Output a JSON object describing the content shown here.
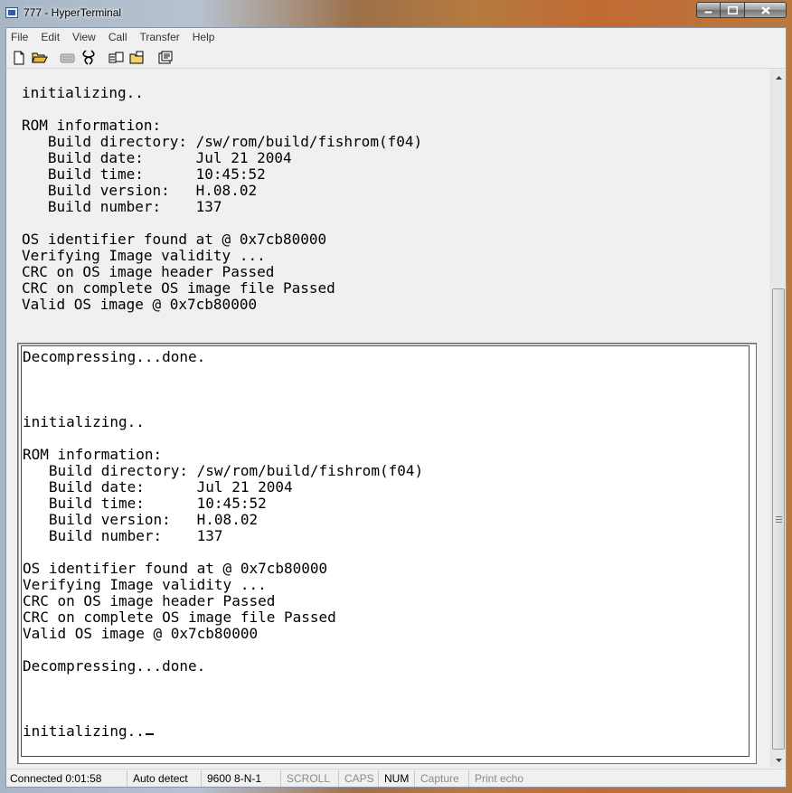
{
  "window": {
    "title": "777 - HyperTerminal",
    "minimize_glyph": "▬",
    "maximize_glyph": "□",
    "close_glyph": "✕"
  },
  "menu": [
    "File",
    "Edit",
    "View",
    "Call",
    "Transfer",
    "Help"
  ],
  "toolbar": {
    "icons": [
      "new-icon",
      "open-icon",
      "connect-icon",
      "disconnect-icon",
      "send-icon",
      "receive-icon",
      "properties-icon"
    ]
  },
  "terminal": {
    "history_lines": [
      "initializing..",
      "",
      "ROM information:",
      "   Build directory: /sw/rom/build/fishrom(f04)",
      "   Build date:      Jul 21 2004",
      "   Build time:      10:45:52",
      "   Build version:   H.08.02",
      "   Build number:    137",
      "",
      "OS identifier found at @ 0x7cb80000",
      "Verifying Image validity ...",
      "CRC on OS image header Passed",
      "CRC on complete OS image file Passed",
      "Valid OS image @ 0x7cb80000"
    ],
    "screen_lines": [
      "Decompressing...done.",
      "",
      "",
      "",
      "initializing..",
      "",
      "ROM information:",
      "   Build directory: /sw/rom/build/fishrom(f04)",
      "   Build date:      Jul 21 2004",
      "   Build time:      10:45:52",
      "   Build version:   H.08.02",
      "   Build number:    137",
      "",
      "OS identifier found at @ 0x7cb80000",
      "Verifying Image validity ...",
      "CRC on OS image header Passed",
      "CRC on complete OS image file Passed",
      "Valid OS image @ 0x7cb80000",
      "",
      "Decompressing...done.",
      "",
      "",
      "",
      "initializing.."
    ]
  },
  "statusbar": {
    "connected": "Connected 0:01:58",
    "detect": "Auto detect",
    "settings": "9600 8-N-1",
    "scroll": "SCROLL",
    "caps": "CAPS",
    "num": "NUM",
    "capture": "Capture",
    "print_echo": "Print echo"
  }
}
